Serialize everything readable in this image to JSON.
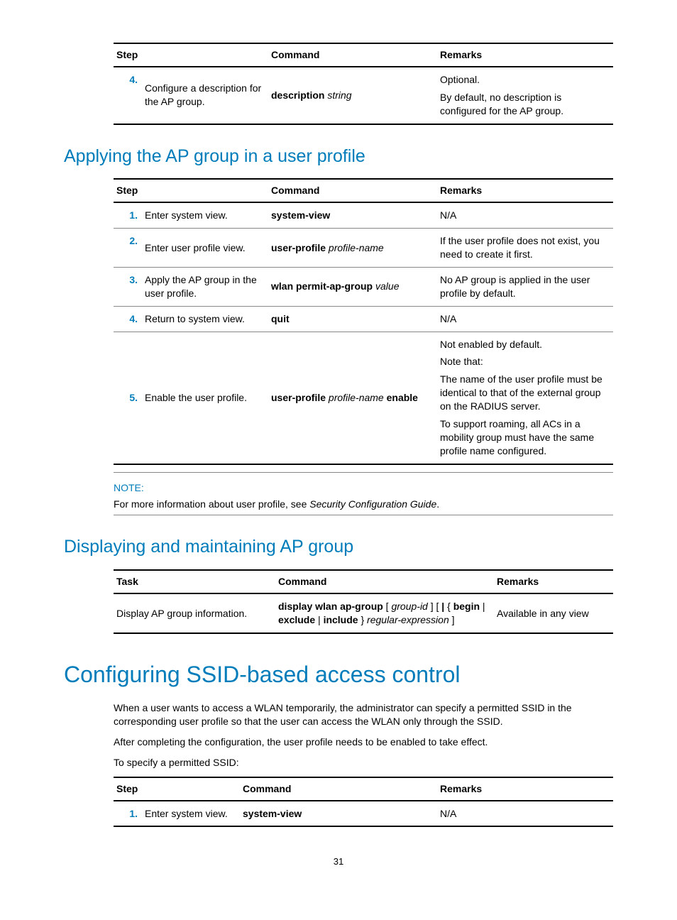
{
  "table1": {
    "h1": "Step",
    "h2": "Command",
    "h3": "Remarks",
    "r1": {
      "num": "4.",
      "step": "Configure a description for the AP group.",
      "cmd_b": "description",
      "cmd_i": " string",
      "rem1": "Optional.",
      "rem2": "By default, no description is configured for the AP group."
    }
  },
  "sec1": {
    "title": "Applying the AP group in a user profile",
    "h1": "Step",
    "h2": "Command",
    "h3": "Remarks",
    "r1": {
      "num": "1.",
      "step": "Enter system view.",
      "cmd_b": "system-view",
      "rem": "N/A"
    },
    "r2": {
      "num": "2.",
      "step": "Enter user profile view.",
      "cmd_b": "user-profile",
      "cmd_i": " profile-name",
      "rem": "If the user profile does not exist, you need to create it first."
    },
    "r3": {
      "num": "3.",
      "step": "Apply the AP group in the user profile.",
      "cmd_b": "wlan permit-ap-group",
      "cmd_i": " value",
      "rem": "No AP group is applied in the user profile by default."
    },
    "r4": {
      "num": "4.",
      "step": "Return to system view.",
      "cmd_b": "quit",
      "rem": "N/A"
    },
    "r5": {
      "num": "5.",
      "step": "Enable the user profile.",
      "cmd_b1": "user-profile",
      "cmd_i1": " profile-name ",
      "cmd_b2": "enable",
      "rem1": "Not enabled by default.",
      "rem2": "Note that:",
      "rem3": "The name of the user profile must be identical to that of the external group on the RADIUS server.",
      "rem4": "To support roaming, all ACs in a mobility group must have the same profile name configured."
    },
    "note_label": "NOTE:",
    "note_pre": "For more information about user profile, see ",
    "note_i": "Security Configuration Guide",
    "note_post": "."
  },
  "sec2": {
    "title": "Displaying and maintaining AP group",
    "h1": "Task",
    "h2": "Command",
    "h3": "Remarks",
    "r1": {
      "task": "Display AP group information.",
      "c1": "display wlan ap-group",
      "c2": " [ ",
      "c3": "group-id",
      "c4": " ] [ ",
      "c5": "|",
      "c6": " { ",
      "c7": "begin",
      "c8": " | ",
      "c9": "exclude",
      "c10": " | ",
      "c11": "include",
      "c12": " } ",
      "c13": "regular-expression",
      "c14": " ]",
      "rem": "Available in any view"
    }
  },
  "sec3": {
    "title": "Configuring SSID-based access control",
    "p1": "When a user wants to access a WLAN temporarily, the administrator can specify a permitted SSID in the corresponding user profile so that the user can access the WLAN only through the SSID.",
    "p2": "After completing the configuration, the user profile needs to be enabled to take effect.",
    "p3": "To specify a permitted SSID:",
    "h1": "Step",
    "h2": "Command",
    "h3": "Remarks",
    "r1": {
      "num": "1.",
      "step": "Enter system view.",
      "cmd_b": "system-view",
      "rem": "N/A"
    }
  },
  "page": "31"
}
